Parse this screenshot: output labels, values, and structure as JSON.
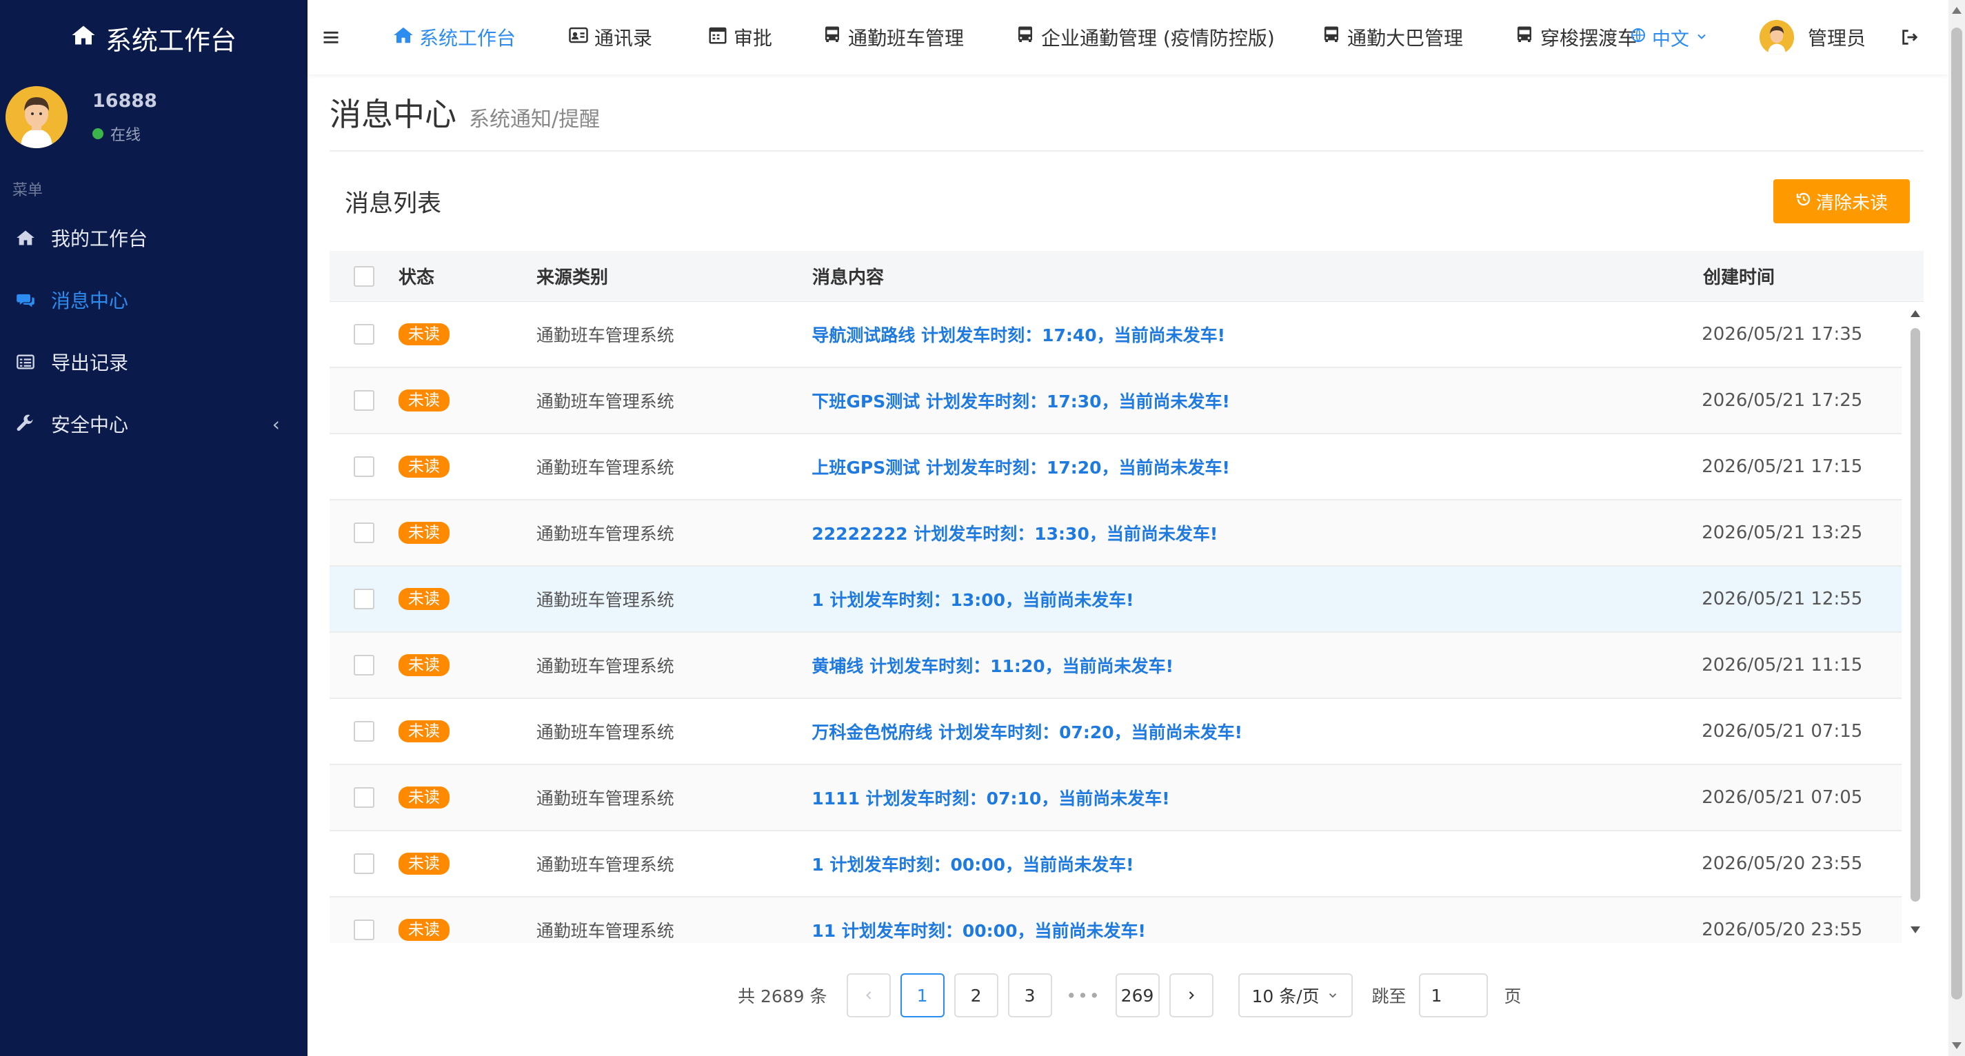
{
  "sidebar": {
    "brand": "系统工作台",
    "user": {
      "name": "16888",
      "status": "在线"
    },
    "menu_header": "菜单",
    "items": [
      {
        "label": "我的工作台",
        "icon": "home-icon"
      },
      {
        "label": "消息中心",
        "icon": "comments-icon",
        "active": true
      },
      {
        "label": "导出记录",
        "icon": "list-icon"
      },
      {
        "label": "安全中心",
        "icon": "wrench-icon"
      }
    ]
  },
  "topnav": {
    "items": [
      {
        "label": "系统工作台",
        "icon": "home-icon",
        "active": true
      },
      {
        "label": "通讯录",
        "icon": "address-card-icon"
      },
      {
        "label": "审批",
        "icon": "calendar-icon"
      },
      {
        "label": "通勤班车管理",
        "icon": "bus-icon"
      },
      {
        "label": "企业通勤管理 (疫情防控版)",
        "icon": "bus-icon"
      },
      {
        "label": "通勤大巴管理",
        "icon": "bus-icon"
      },
      {
        "label": "穿梭摆渡车",
        "icon": "bus-icon"
      }
    ],
    "language": "中文",
    "admin": "管理员"
  },
  "page": {
    "title": "消息中心",
    "subtitle": "系统通知/提醒"
  },
  "list": {
    "title": "消息列表",
    "clear_button": "清除未读",
    "columns": {
      "status": "状态",
      "source": "来源类别",
      "content": "消息内容",
      "time": "创建时间"
    },
    "rows": [
      {
        "status": "未读",
        "source": "通勤班车管理系统",
        "content": "导航测试路线 计划发车时刻：17:40，当前尚未发车!",
        "time": "2026/05/21 17:35"
      },
      {
        "status": "未读",
        "source": "通勤班车管理系统",
        "content": "下班GPS测试 计划发车时刻：17:30，当前尚未发车!",
        "time": "2026/05/21 17:25"
      },
      {
        "status": "未读",
        "source": "通勤班车管理系统",
        "content": "上班GPS测试 计划发车时刻：17:20，当前尚未发车!",
        "time": "2026/05/21 17:15"
      },
      {
        "status": "未读",
        "source": "通勤班车管理系统",
        "content": "22222222 计划发车时刻：13:30，当前尚未发车!",
        "time": "2026/05/21 13:25"
      },
      {
        "status": "未读",
        "source": "通勤班车管理系统",
        "content": "1 计划发车时刻：13:00，当前尚未发车!",
        "time": "2026/05/21 12:55"
      },
      {
        "status": "未读",
        "source": "通勤班车管理系统",
        "content": "黄埔线 计划发车时刻：11:20，当前尚未发车!",
        "time": "2026/05/21 11:15"
      },
      {
        "status": "未读",
        "source": "通勤班车管理系统",
        "content": "万科金色悦府线 计划发车时刻：07:20，当前尚未发车!",
        "time": "2026/05/21 07:15"
      },
      {
        "status": "未读",
        "source": "通勤班车管理系统",
        "content": "1111 计划发车时刻：07:10，当前尚未发车!",
        "time": "2026/05/21 07:05"
      },
      {
        "status": "未读",
        "source": "通勤班车管理系统",
        "content": "1 计划发车时刻：00:00，当前尚未发车!",
        "time": "2026/05/20 23:55"
      },
      {
        "status": "未读",
        "source": "通勤班车管理系统",
        "content": "11 计划发车时刻：00:00，当前尚未发车!",
        "time": "2026/05/20 23:55"
      }
    ]
  },
  "pagination": {
    "total_text": "共 2689 条",
    "pages": [
      "1",
      "2",
      "3"
    ],
    "ellipsis": "•••",
    "last_page": "269",
    "current": "1",
    "page_size": "10 条/页",
    "jump_label": "跳至",
    "jump_value": "1",
    "page_suffix": "页"
  },
  "colors": {
    "sidebar_bg": "#0a1a4a",
    "accent": "#2d8cf0",
    "warning": "#ff9900",
    "badge": "#ff8a00"
  }
}
